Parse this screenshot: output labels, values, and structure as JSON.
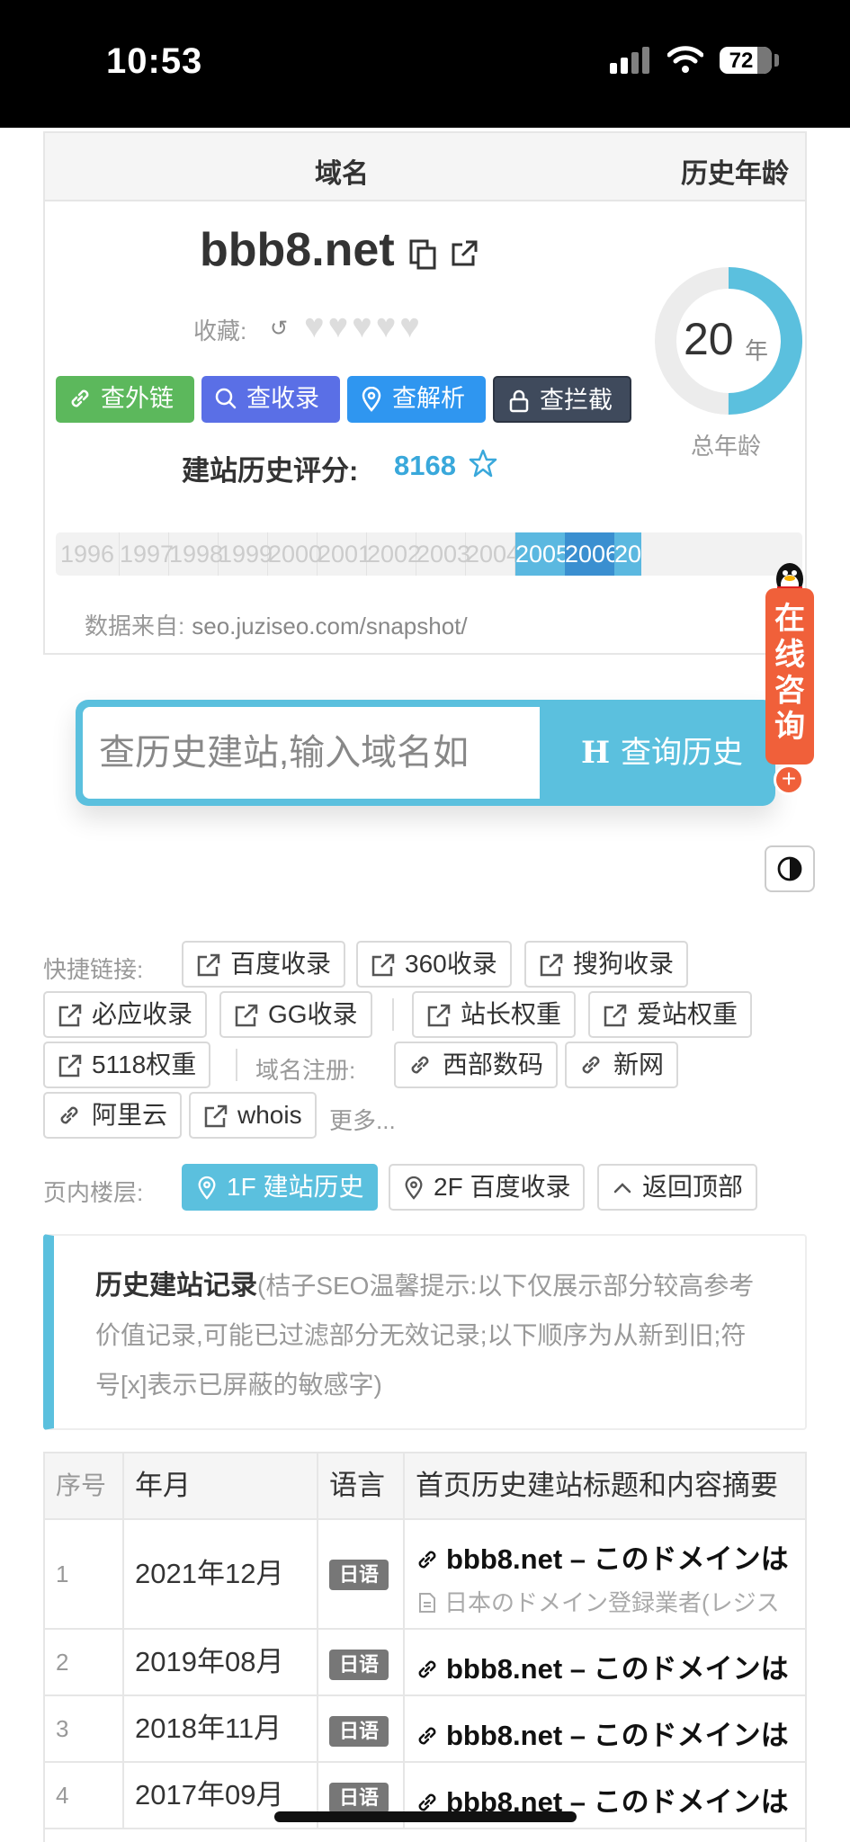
{
  "status": {
    "time": "10:53",
    "battery_level": 72,
    "battery_text": "72"
  },
  "header": {
    "col_domain": "域名",
    "col_age": "历史年龄"
  },
  "domain": {
    "name": "bbb8.net",
    "favorite_label": "收藏:",
    "hearts_count": 5,
    "buttons": [
      {
        "label": "查外链",
        "icon": "link-icon",
        "color": "#5cb85c"
      },
      {
        "label": "查收录",
        "icon": "search-icon",
        "color": "#5a6fe6"
      },
      {
        "label": "查解析",
        "icon": "location-icon",
        "color": "#2f96f0"
      },
      {
        "label": "查拦截",
        "icon": "lock-icon",
        "color": "#3f4a5c"
      }
    ],
    "score_label": "建站历史评分:",
    "score_value": "8168"
  },
  "age": {
    "years": "20",
    "unit": "年",
    "label": "总年龄",
    "ring_fraction": 0.5
  },
  "years": [
    "1996",
    "1997",
    "1998",
    "1999",
    "2000",
    "2001",
    "2002",
    "2003",
    "2004",
    "2005",
    "2006",
    "20"
  ],
  "years_active": [
    "2005",
    "2006",
    "20"
  ],
  "source": {
    "label": "数据来自:",
    "url": "seo.juziseo.com/snapshot/"
  },
  "search": {
    "placeholder": "查历史建站,输入域名如",
    "button_label": "查询历史",
    "button_glyph": "H"
  },
  "consult": {
    "text": "在线咨询"
  },
  "quick_links": {
    "label": "快捷链接:",
    "items": [
      "百度收录",
      "360收录",
      "搜狗收录",
      "必应收录",
      "GG收录",
      "站长权重",
      "爱站权重",
      "5118权重"
    ],
    "register_label": "域名注册:",
    "registrars": [
      "西部数码",
      "新网",
      "阿里云"
    ],
    "whois": "whois",
    "more": "更多..."
  },
  "floors": {
    "label": "页内楼层:",
    "items": [
      "1F 建站历史",
      "2F 百度收录",
      "返回顶部"
    ]
  },
  "notice": {
    "title": "历史建站记录",
    "text": "(桔子SEO温馨提示:以下仅展示部分较高参考价值记录,可能已过滤部分无效记录;以下顺序为从新到旧;符号[x]表示已屏蔽的敏感字)"
  },
  "table": {
    "headers": [
      "序号",
      "年月",
      "语言",
      "首页历史建站标题和内容摘要"
    ],
    "rows": [
      {
        "index": "1",
        "date": "2021年12月",
        "lang": "日语",
        "title": "bbb8.net – このドメインは",
        "summary": "日本のドメイン登録業者(レジス"
      },
      {
        "index": "2",
        "date": "2019年08月",
        "lang": "日语",
        "title": "bbb8.net – このドメインは"
      },
      {
        "index": "3",
        "date": "2018年11月",
        "lang": "日语",
        "title": "bbb8.net – このドメインは"
      },
      {
        "index": "4",
        "date": "2017年09月",
        "lang": "日语",
        "title": "bbb8.net – このドメインは"
      }
    ]
  },
  "colors": {
    "accent": "#5bc0de",
    "score": "#39a8db",
    "year_active": "#5bb8e0",
    "year_active_dark": "#3a8fd0",
    "consult": "#f0603a"
  }
}
